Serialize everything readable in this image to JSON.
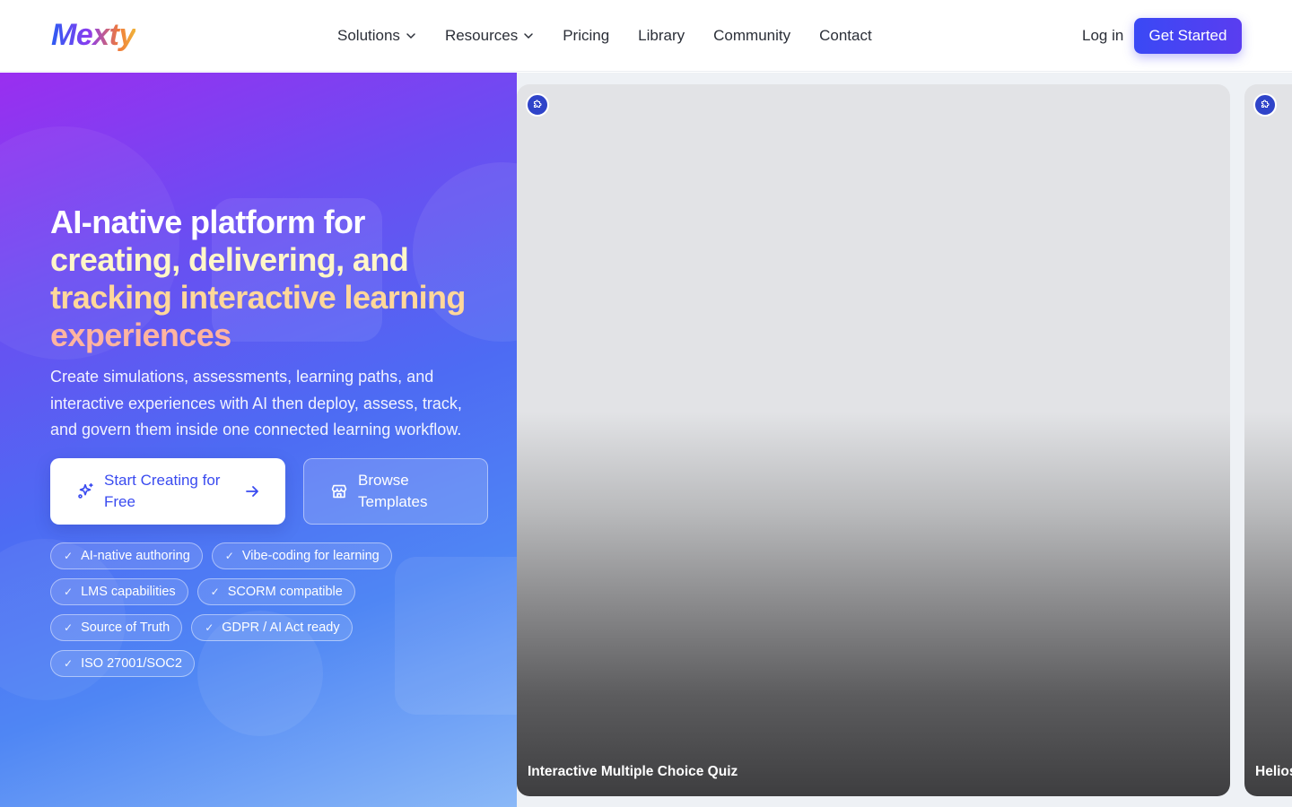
{
  "header": {
    "logo": "Mexty",
    "nav": [
      {
        "label": "Solutions",
        "has_dropdown": true
      },
      {
        "label": "Resources",
        "has_dropdown": true
      },
      {
        "label": "Pricing",
        "has_dropdown": false
      },
      {
        "label": "Library",
        "has_dropdown": false
      },
      {
        "label": "Community",
        "has_dropdown": false
      },
      {
        "label": "Contact",
        "has_dropdown": false
      }
    ],
    "login_label": "Log in",
    "cta_label": "Get Started"
  },
  "hero": {
    "headline": {
      "line1": "AI-native platform for",
      "line2": "creating, delivering, and",
      "line3": "tracking interactive learning",
      "line4": "experiences"
    },
    "description": "Create simulations, assessments, learning paths, and interactive experiences with AI then deploy, assess, track, and govern them inside one connected learning workflow.",
    "primary_button": {
      "label": "Start Creating for Free",
      "icon": "sparkles-icon"
    },
    "secondary_button": {
      "label": "Browse Templates",
      "icon": "store-icon"
    },
    "tags": [
      [
        "AI-native authoring",
        "Vibe-coding for learning"
      ],
      [
        "LMS capabilities",
        "SCORM compatible"
      ],
      [
        "Source of Truth",
        "GDPR / AI Act ready"
      ],
      [
        "ISO 27001/SOC2"
      ]
    ],
    "tag_check": "✓"
  },
  "gallery": {
    "cards": [
      {
        "title": "Interactive Multiple Choice Quiz",
        "badge_icon": "puzzle-icon"
      },
      {
        "title": "Helios",
        "badge_icon": "puzzle-icon"
      }
    ]
  },
  "colors": {
    "accent": "#3a4bf0",
    "badge": "#2f44c9",
    "hero_gradient_start": "#9a2ef0",
    "hero_gradient_end": "#8ab8f7"
  }
}
